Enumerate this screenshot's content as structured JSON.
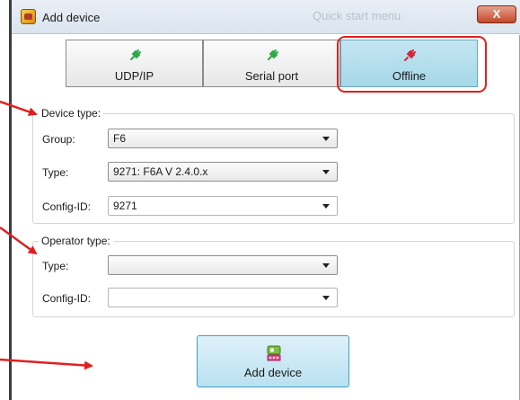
{
  "window": {
    "title": "Add device",
    "ghost_text": "Quick start menu",
    "close_label": "X"
  },
  "mode_tabs": [
    {
      "label": "UDP/IP",
      "icon": "green-plug-icon",
      "active": false
    },
    {
      "label": "Serial port",
      "icon": "green-plug-icon",
      "active": false
    },
    {
      "label": "Offline",
      "icon": "red-plug-icon",
      "active": true
    }
  ],
  "device_type": {
    "legend": "Device type:",
    "group_label": "Group:",
    "group_value": "F6",
    "type_label": "Type:",
    "type_value": "9271: F6A V 2.4.0.x",
    "config_label": "Config-ID:",
    "config_value": "9271"
  },
  "operator_type": {
    "legend": "Operator type:",
    "type_label": "Type:",
    "type_value": "",
    "config_label": "Config-ID:",
    "config_value": ""
  },
  "add_button": {
    "label": "Add device",
    "icon": "keyboard-device-icon"
  },
  "colors": {
    "active_tab": "#a6d7e8",
    "annotation_red": "#e02020",
    "plug_green": "#2fa84a",
    "plug_red": "#d2283a"
  }
}
